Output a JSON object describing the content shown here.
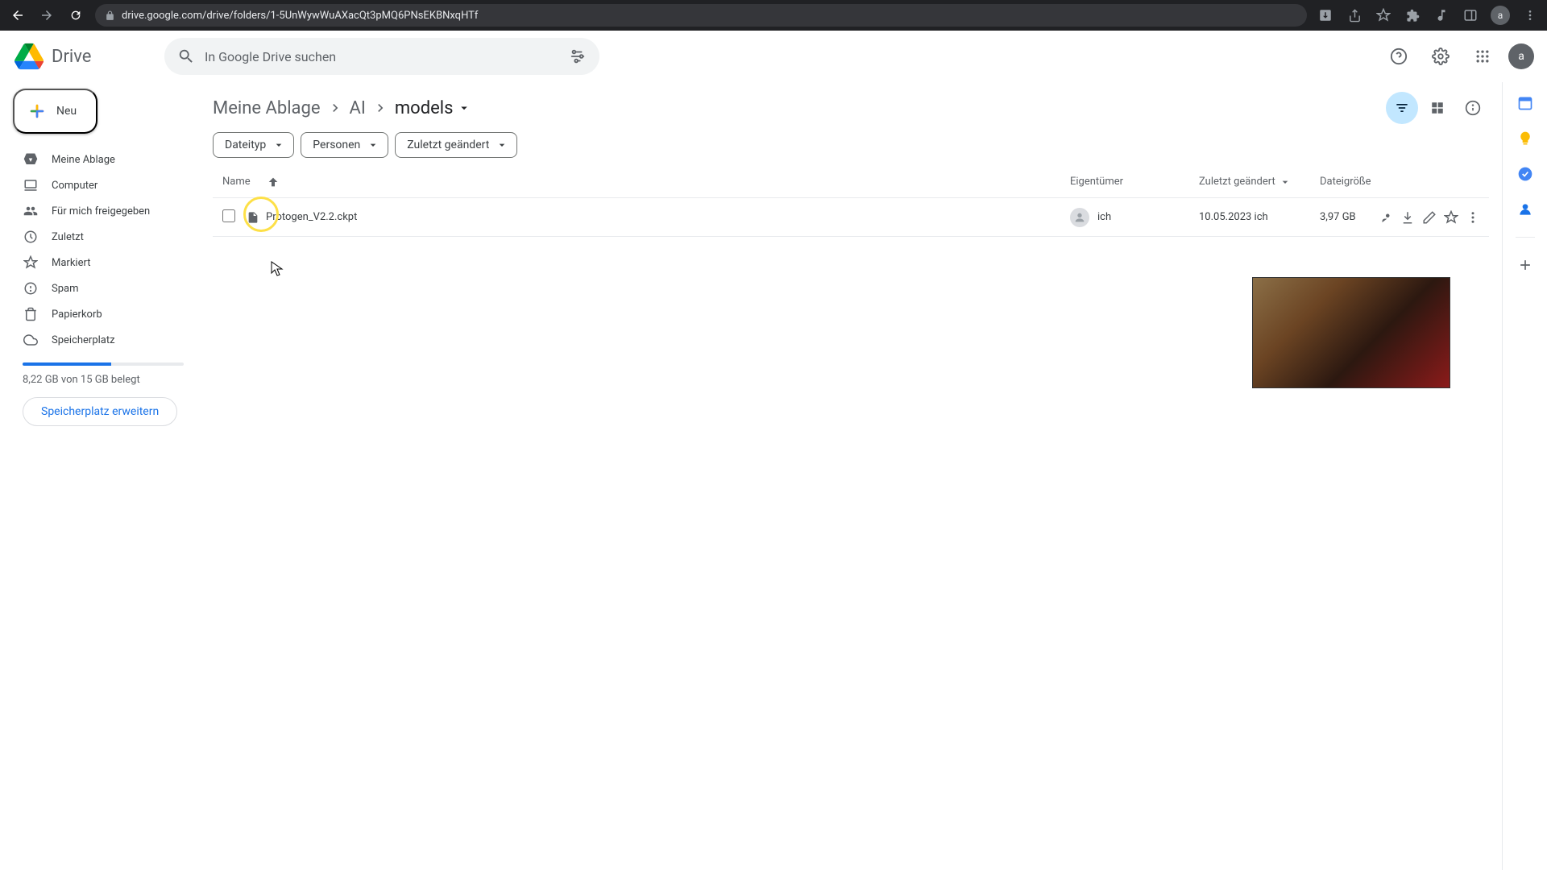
{
  "browser": {
    "url": "drive.google.com/drive/folders/1-5UnWywWuAXacQt3pMQ6PNsEKBNxqHTf",
    "avatar": "a"
  },
  "header": {
    "app_name": "Drive",
    "search_placeholder": "In Google Drive suchen",
    "avatar": "a"
  },
  "sidebar": {
    "new_label": "Neu",
    "items": [
      {
        "label": "Meine Ablage"
      },
      {
        "label": "Computer"
      },
      {
        "label": "Für mich freigegeben"
      },
      {
        "label": "Zuletzt"
      },
      {
        "label": "Markiert"
      },
      {
        "label": "Spam"
      },
      {
        "label": "Papierkorb"
      },
      {
        "label": "Speicherplatz"
      }
    ],
    "storage_text": "8,22 GB von 15 GB belegt",
    "upgrade_label": "Speicherplatz erweitern"
  },
  "breadcrumb": {
    "items": [
      "Meine Ablage",
      "AI",
      "models"
    ]
  },
  "filters": {
    "type": "Dateityp",
    "people": "Personen",
    "modified": "Zuletzt geändert"
  },
  "columns": {
    "name": "Name",
    "owner": "Eigentümer",
    "modified": "Zuletzt geändert",
    "size": "Dateigröße"
  },
  "files": [
    {
      "name": "Protogen_V2.2.ckpt",
      "owner": "ich",
      "modified": "10.05.2023",
      "modified_by": "ich",
      "size": "3,97 GB"
    }
  ]
}
